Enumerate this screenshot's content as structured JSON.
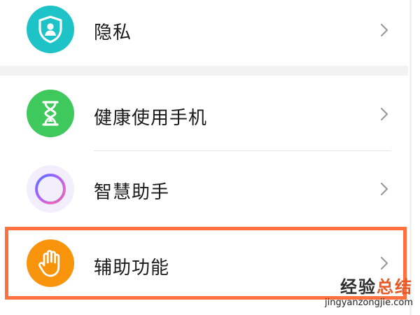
{
  "settings": {
    "items": [
      {
        "label": "隐私",
        "icon": "shield-user-icon",
        "color": "#1ec3c8"
      },
      {
        "label": "健康使用手机",
        "icon": "hourglass-icon",
        "color": "#3fc85b"
      },
      {
        "label": "智慧助手",
        "icon": "ring-assistant-icon",
        "color": "#f0e8ff"
      },
      {
        "label": "辅助功能",
        "icon": "hand-icon",
        "color": "#f7940c"
      }
    ]
  },
  "watermark": {
    "title_main": "经验",
    "title_accent": "总结",
    "url": "jingyanzongjie.com"
  },
  "colors": {
    "highlight": "#ff7040",
    "chevron": "#9a9a9a"
  }
}
